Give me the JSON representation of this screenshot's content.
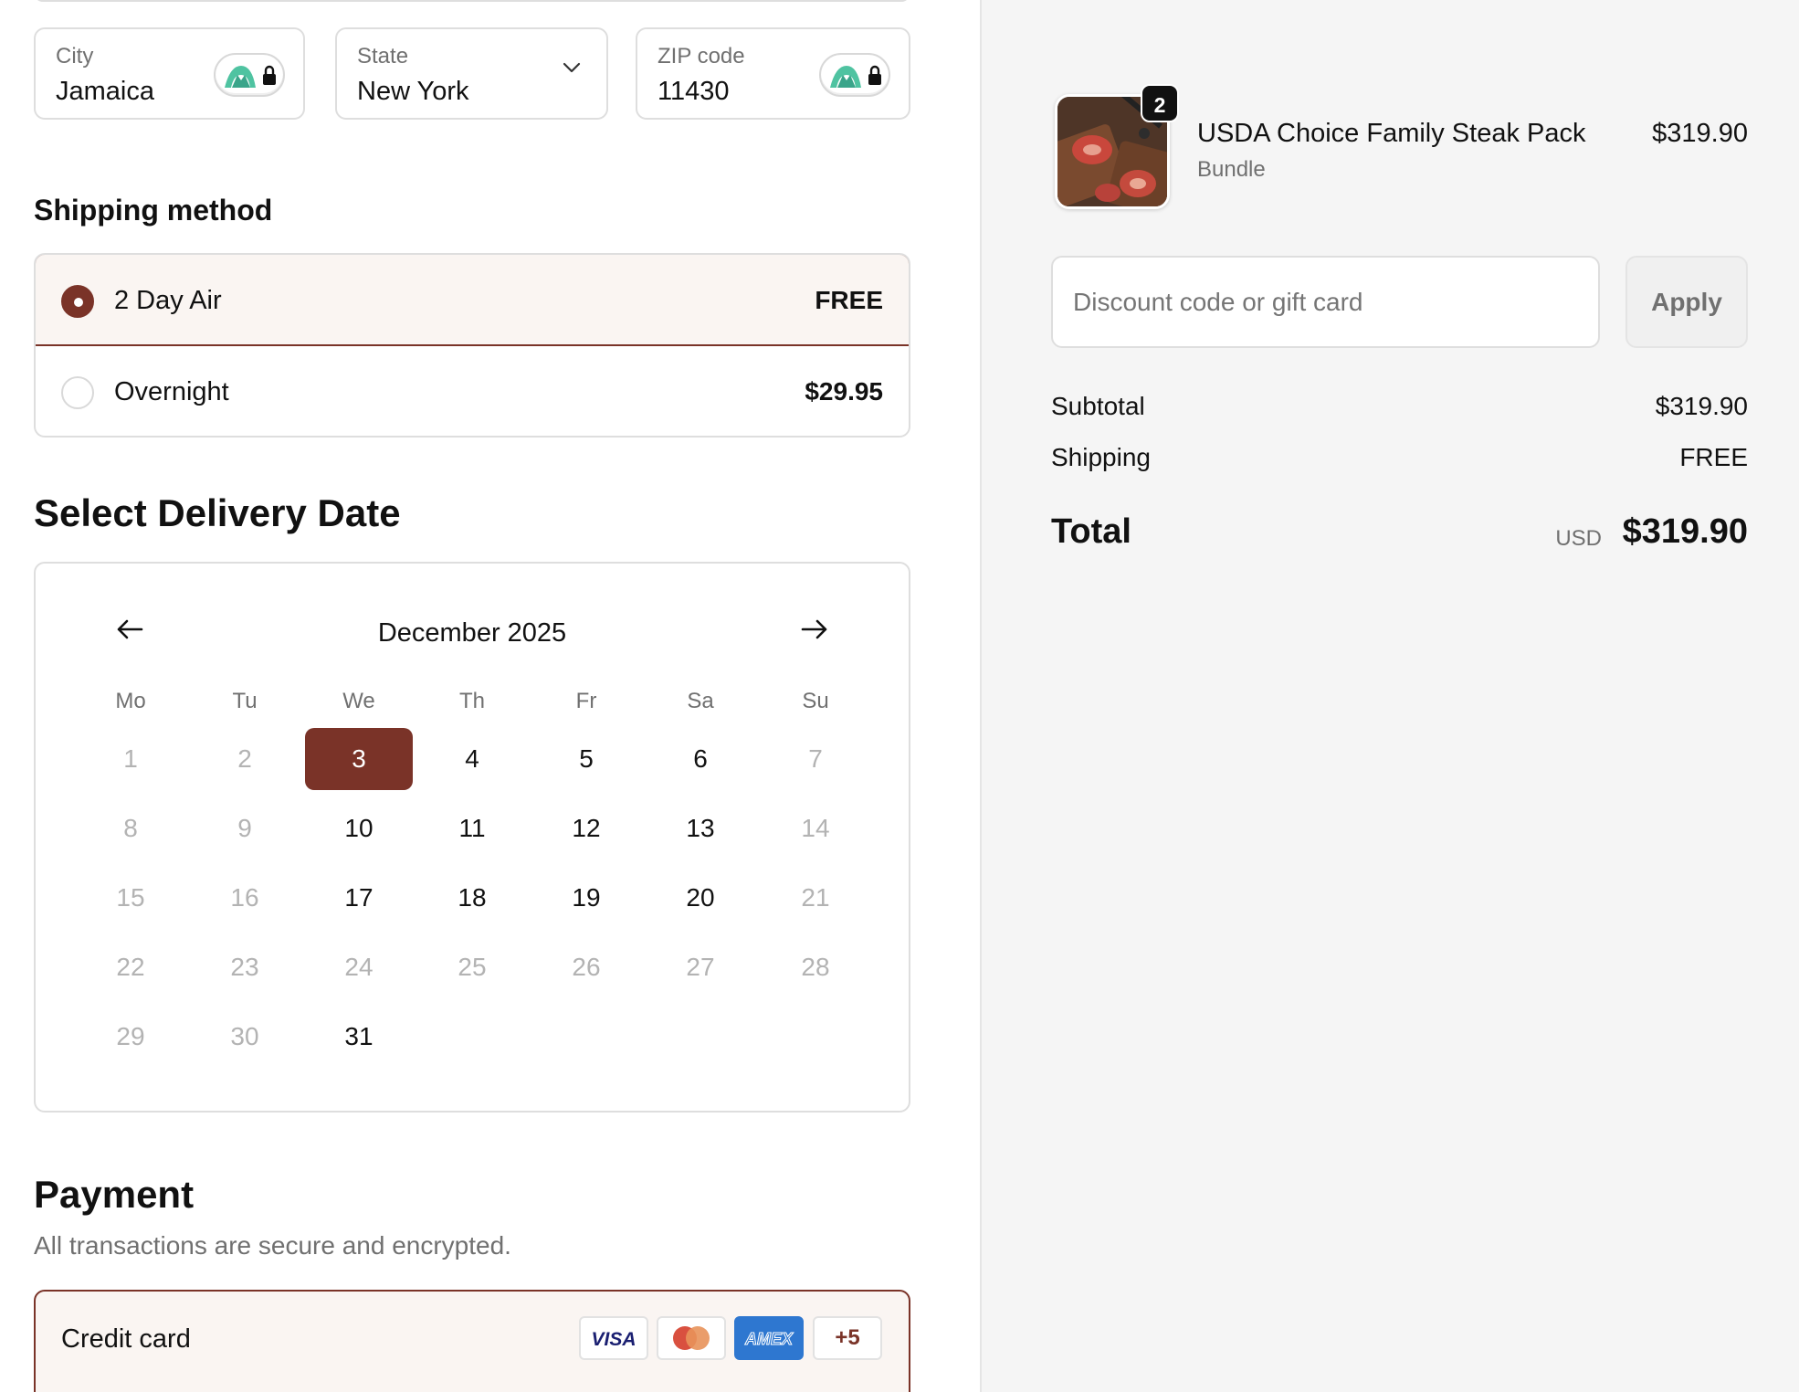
{
  "address": {
    "city_label": "City",
    "city_value": "Jamaica",
    "state_label": "State",
    "state_value": "New York",
    "zip_label": "ZIP code",
    "zip_value": "11430"
  },
  "shipping": {
    "title": "Shipping method",
    "options": [
      {
        "name": "2 Day Air",
        "price": "FREE",
        "selected": true
      },
      {
        "name": "Overnight",
        "price": "$29.95",
        "selected": false
      }
    ]
  },
  "delivery": {
    "title": "Select Delivery Date",
    "month": "December 2025",
    "weekdays": [
      "Mo",
      "Tu",
      "We",
      "Th",
      "Fr",
      "Sa",
      "Su"
    ],
    "days": [
      1,
      2,
      3,
      4,
      5,
      6,
      7,
      8,
      9,
      10,
      11,
      12,
      13,
      14,
      15,
      16,
      17,
      18,
      19,
      20,
      21,
      22,
      23,
      24,
      25,
      26,
      27,
      28,
      29,
      30,
      31
    ],
    "enabled_days": [
      3,
      4,
      5,
      6,
      10,
      11,
      12,
      13,
      17,
      18,
      19,
      20,
      31
    ],
    "selected_day": 3
  },
  "payment": {
    "title": "Payment",
    "subtitle": "All transactions are secure and encrypted.",
    "method_label": "Credit card",
    "cards": [
      "VISA",
      "Mastercard",
      "AMEX"
    ],
    "more_cards": "+5"
  },
  "order": {
    "quantity": "2",
    "product_name": "USDA Choice Family Steak Pack",
    "product_variant": "Bundle",
    "product_price": "$319.90",
    "discount_placeholder": "Discount code or gift card",
    "apply_label": "Apply",
    "subtotal_label": "Subtotal",
    "subtotal_value": "$319.90",
    "shipping_label": "Shipping",
    "shipping_value": "FREE",
    "total_label": "Total",
    "currency": "USD",
    "total_value": "$319.90"
  },
  "colors": {
    "accent": "#7a3328",
    "selected_bg": "#faf5f2",
    "muted_text": "#707070",
    "summary_bg": "#f5f5f5"
  }
}
